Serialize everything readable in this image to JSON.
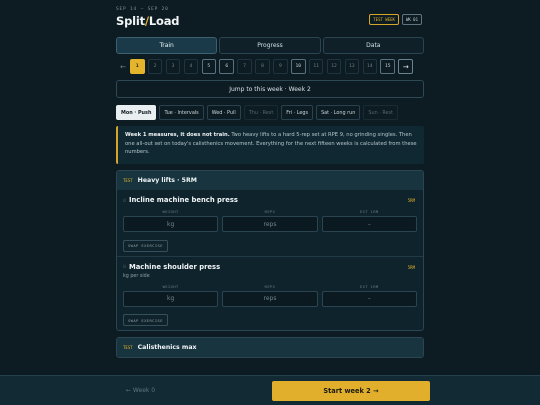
{
  "header": {
    "dates": "SEP 14 – SEP 20",
    "brand_left": "Split",
    "brand_slash": "/",
    "brand_right": "Load",
    "badge_test": "TEST WEEK",
    "badge_week": "WK 01"
  },
  "tabs": [
    {
      "label": "Train",
      "active": true
    },
    {
      "label": "Progress",
      "active": false
    },
    {
      "label": "Data",
      "active": false
    }
  ],
  "weeks": {
    "prev_label": "←",
    "next_label": "→",
    "items": [
      {
        "label": "1",
        "state": "active"
      },
      {
        "label": "2",
        "state": "normal"
      },
      {
        "label": "3",
        "state": "normal"
      },
      {
        "label": "4",
        "state": "normal"
      },
      {
        "label": "5",
        "state": "highlight"
      },
      {
        "label": "6",
        "state": "highlight"
      },
      {
        "label": "7",
        "state": "normal"
      },
      {
        "label": "8",
        "state": "normal"
      },
      {
        "label": "9",
        "state": "normal"
      },
      {
        "label": "10",
        "state": "highlight"
      },
      {
        "label": "11",
        "state": "normal"
      },
      {
        "label": "12",
        "state": "normal"
      },
      {
        "label": "13",
        "state": "normal"
      },
      {
        "label": "14",
        "state": "normal"
      },
      {
        "label": "15",
        "state": "highlight"
      }
    ]
  },
  "jump_label": "Jump to this week · Week 2",
  "days": [
    {
      "label": "Mon · Push",
      "state": "active"
    },
    {
      "label": "Tue · Intervals",
      "state": "normal"
    },
    {
      "label": "Wed · Pull",
      "state": "normal"
    },
    {
      "label": "Thu · Rest",
      "state": "rest"
    },
    {
      "label": "Fri · Legs",
      "state": "normal"
    },
    {
      "label": "Sat · Long run",
      "state": "normal"
    },
    {
      "label": "Sun · Rest",
      "state": "rest"
    }
  ],
  "note": {
    "bold": "Week 1 measures, it does not train.",
    "text": " Two heavy lifts to a hard 5-rep set at RPE 9, no grinding singles. Then one all-out set on today's calisthenics movement. Everything for the next fifteen weeks is calculated from these numbers."
  },
  "sections": {
    "heavy": {
      "tag": "TEST",
      "title": "Heavy lifts · 5RM",
      "exercises": [
        {
          "name": "Incline machine bench press",
          "rm": "5RM",
          "sub": "",
          "col_weight": "WEIGHT",
          "col_reps": "REPS",
          "col_est": "EST 1RM",
          "weight_placeholder": "kg",
          "reps_placeholder": "reps",
          "est_value": "–",
          "swap_label": "SWAP EXERCISE"
        },
        {
          "name": "Machine shoulder press",
          "rm": "5RM",
          "sub": "kg per side",
          "col_weight": "WEIGHT",
          "col_reps": "REPS",
          "col_est": "EST 1RM",
          "weight_placeholder": "kg",
          "reps_placeholder": "reps",
          "est_value": "–",
          "swap_label": "SWAP EXERCISE"
        }
      ]
    },
    "cal": {
      "tag": "TEST",
      "title": "Calisthenics max"
    }
  },
  "footer": {
    "prev_label": "← Week 0",
    "start_label": "Start week 2 →"
  },
  "colors": {
    "accent": "#e4b42d",
    "background": "#0d1b22",
    "panel": "#0f232c"
  }
}
